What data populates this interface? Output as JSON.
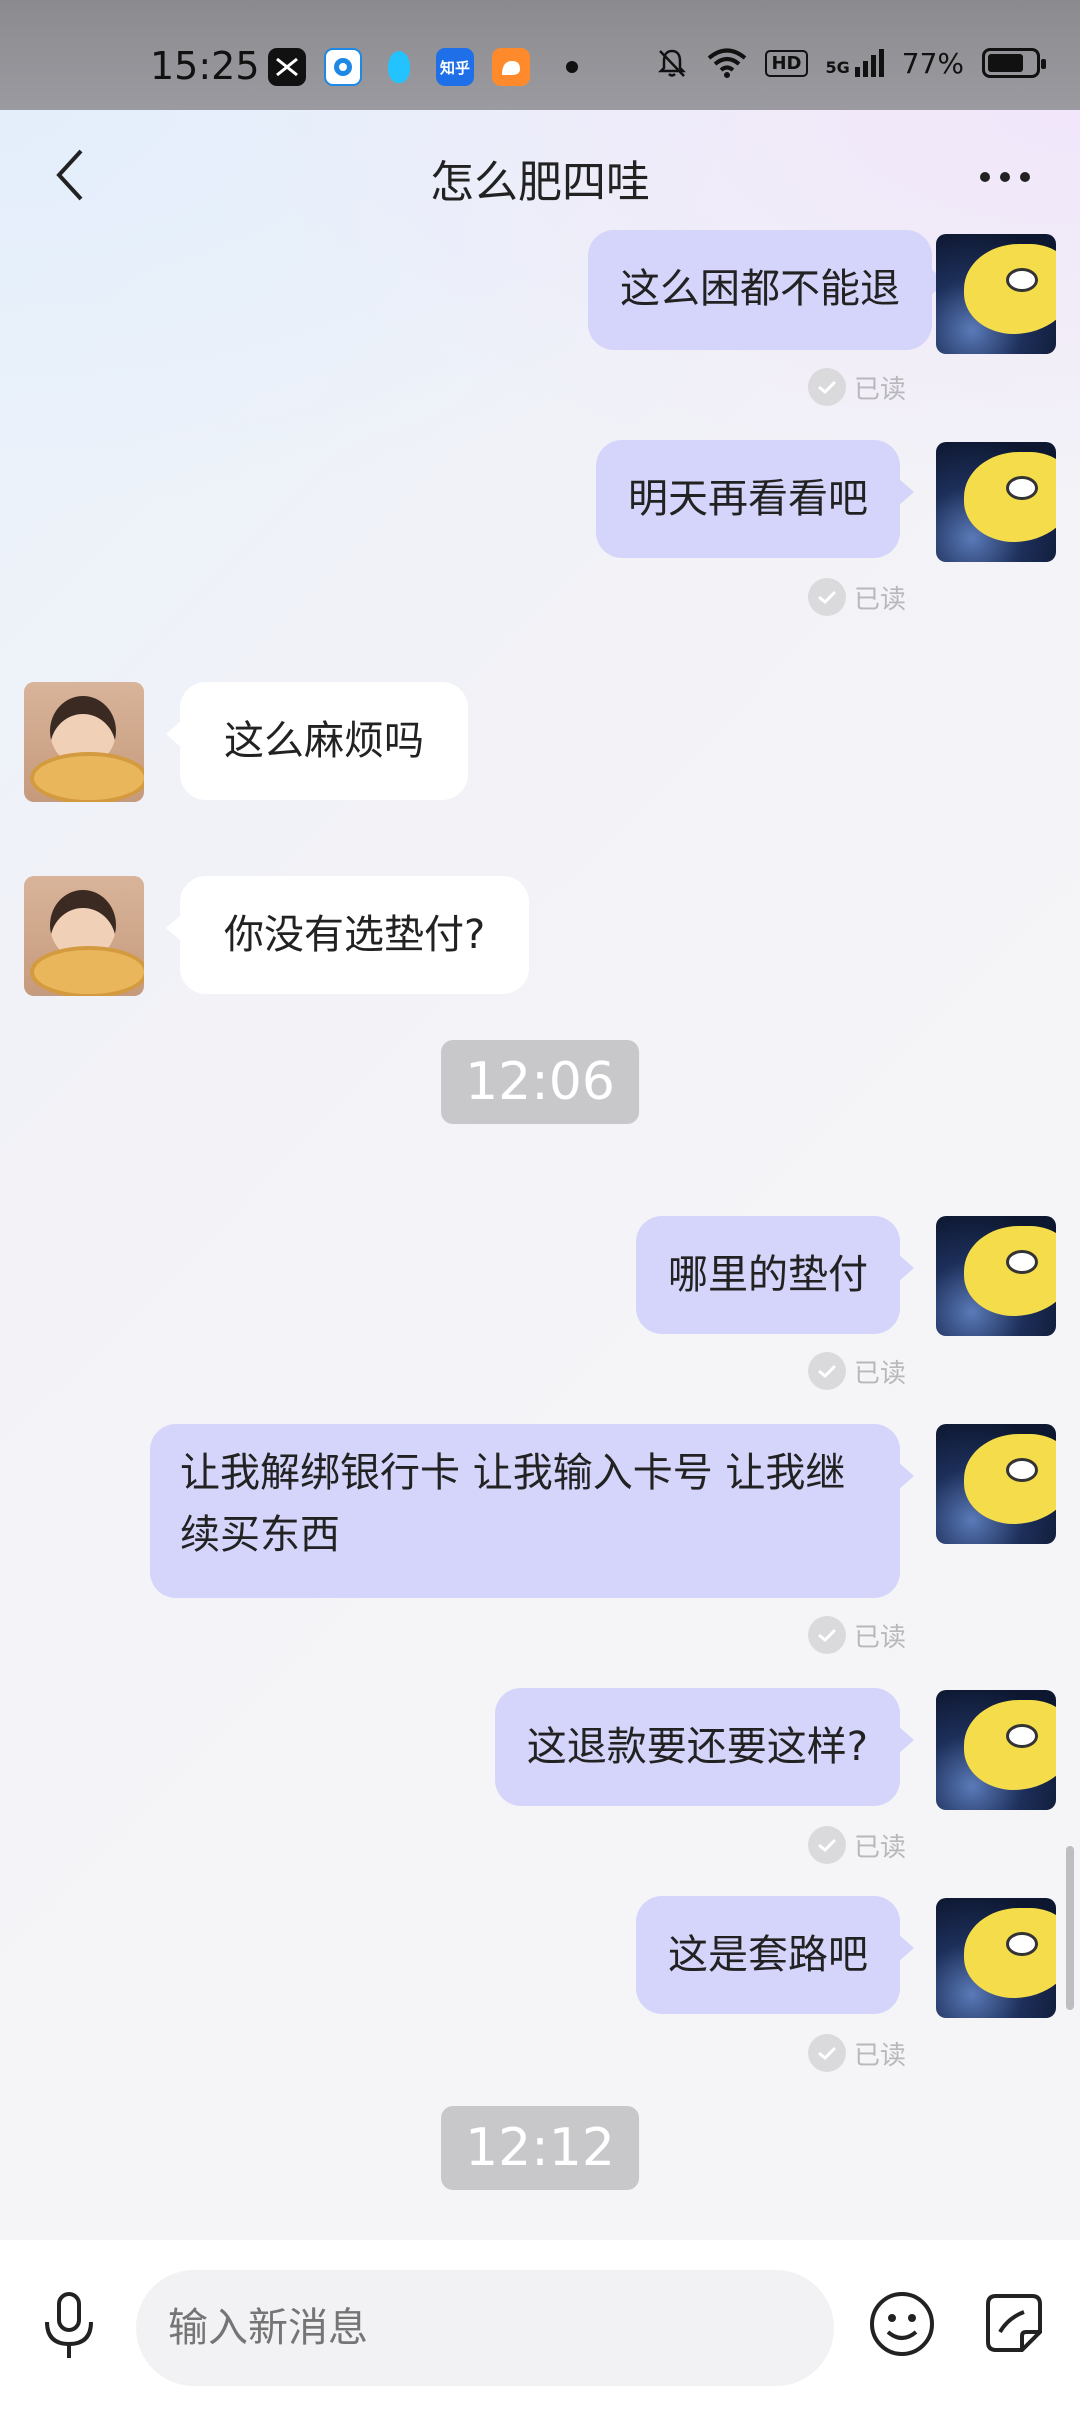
{
  "status_bar": {
    "time": "15:25",
    "apps": [
      "capcut-icon",
      "browser-icon",
      "qq-icon",
      "zhihu-icon",
      "uc-icon"
    ],
    "zhihu_label": "知乎",
    "hd_label": "HD",
    "network_label": "5G",
    "battery": "77%"
  },
  "nav": {
    "title": "怎么肥四哇"
  },
  "messages": [
    {
      "side": "out",
      "text": "这么困都不能退",
      "read_label": "已读"
    },
    {
      "side": "out",
      "text": "明天再看看吧",
      "read_label": "已读"
    },
    {
      "side": "in",
      "text": "这么麻烦吗"
    },
    {
      "side": "in",
      "text": "你没有选垫付?"
    },
    {
      "side": "time",
      "text": "12:06"
    },
    {
      "side": "out",
      "text": "哪里的垫付",
      "read_label": "已读"
    },
    {
      "side": "out",
      "text": "让我解绑银行卡  让我输入卡号 让我继续买东西",
      "read_label": "已读"
    },
    {
      "side": "out",
      "text": "这退款要还要这样?",
      "read_label": "已读"
    },
    {
      "side": "out",
      "text": "这是套路吧",
      "read_label": "已读"
    },
    {
      "side": "time",
      "text": "12:12"
    }
  ],
  "input": {
    "placeholder": "输入新消息"
  },
  "colors": {
    "outgoing_bubble": "#d5d4fa",
    "incoming_bubble": "#ffffff",
    "time_badge": "#c8c8cb",
    "read_text": "#b8b8bc"
  }
}
